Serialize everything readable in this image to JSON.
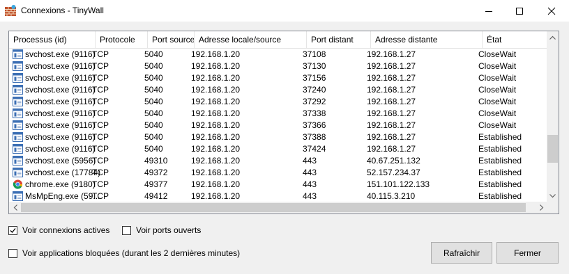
{
  "window": {
    "title": "Connexions - TinyWall"
  },
  "table": {
    "columns": [
      "Processus (id)",
      "Protocole",
      "Port source",
      "Adresse locale/source",
      "Port distant",
      "Adresse distante",
      "État"
    ],
    "rows": [
      {
        "icon": "svchost-icon",
        "process": "svchost.exe (9116)",
        "protocol": "TCP",
        "src_port": "5040",
        "local_addr": "192.168.1.20",
        "dst_port": "37108",
        "remote_addr": "192.168.1.27",
        "state": "CloseWait"
      },
      {
        "icon": "svchost-icon",
        "process": "svchost.exe (9116)",
        "protocol": "TCP",
        "src_port": "5040",
        "local_addr": "192.168.1.20",
        "dst_port": "37130",
        "remote_addr": "192.168.1.27",
        "state": "CloseWait"
      },
      {
        "icon": "svchost-icon",
        "process": "svchost.exe (9116)",
        "protocol": "TCP",
        "src_port": "5040",
        "local_addr": "192.168.1.20",
        "dst_port": "37156",
        "remote_addr": "192.168.1.27",
        "state": "CloseWait"
      },
      {
        "icon": "svchost-icon",
        "process": "svchost.exe (9116)",
        "protocol": "TCP",
        "src_port": "5040",
        "local_addr": "192.168.1.20",
        "dst_port": "37240",
        "remote_addr": "192.168.1.27",
        "state": "CloseWait"
      },
      {
        "icon": "svchost-icon",
        "process": "svchost.exe (9116)",
        "protocol": "TCP",
        "src_port": "5040",
        "local_addr": "192.168.1.20",
        "dst_port": "37292",
        "remote_addr": "192.168.1.27",
        "state": "CloseWait"
      },
      {
        "icon": "svchost-icon",
        "process": "svchost.exe (9116)",
        "protocol": "TCP",
        "src_port": "5040",
        "local_addr": "192.168.1.20",
        "dst_port": "37338",
        "remote_addr": "192.168.1.27",
        "state": "CloseWait"
      },
      {
        "icon": "svchost-icon",
        "process": "svchost.exe (9116)",
        "protocol": "TCP",
        "src_port": "5040",
        "local_addr": "192.168.1.20",
        "dst_port": "37366",
        "remote_addr": "192.168.1.27",
        "state": "CloseWait"
      },
      {
        "icon": "svchost-icon",
        "process": "svchost.exe (9116)",
        "protocol": "TCP",
        "src_port": "5040",
        "local_addr": "192.168.1.20",
        "dst_port": "37388",
        "remote_addr": "192.168.1.27",
        "state": "Established"
      },
      {
        "icon": "svchost-icon",
        "process": "svchost.exe (9116)",
        "protocol": "TCP",
        "src_port": "5040",
        "local_addr": "192.168.1.20",
        "dst_port": "37424",
        "remote_addr": "192.168.1.27",
        "state": "Established"
      },
      {
        "icon": "svchost-icon",
        "process": "svchost.exe (5956)",
        "protocol": "TCP",
        "src_port": "49310",
        "local_addr": "192.168.1.20",
        "dst_port": "443",
        "remote_addr": "40.67.251.132",
        "state": "Established"
      },
      {
        "icon": "svchost-icon",
        "process": "svchost.exe (17784)",
        "protocol": "TCP",
        "src_port": "49372",
        "local_addr": "192.168.1.20",
        "dst_port": "443",
        "remote_addr": "52.157.234.37",
        "state": "Established"
      },
      {
        "icon": "chrome-icon",
        "process": "chrome.exe (9180)",
        "protocol": "TCP",
        "src_port": "49377",
        "local_addr": "192.168.1.20",
        "dst_port": "443",
        "remote_addr": "151.101.122.133",
        "state": "Established"
      },
      {
        "icon": "svchost-icon",
        "process": "MsMpEng.exe (59...",
        "protocol": "TCP",
        "src_port": "49412",
        "local_addr": "192.168.1.20",
        "dst_port": "443",
        "remote_addr": "40.115.3.210",
        "state": "Established"
      }
    ]
  },
  "options": {
    "show_active": {
      "label": "Voir connexions actives",
      "checked": true
    },
    "show_open_ports": {
      "label": "Voir ports ouverts",
      "checked": false
    },
    "show_blocked": {
      "label": "Voir applications bloquées (durant les 2 dernières minutes)",
      "checked": false
    }
  },
  "buttons": {
    "refresh": "Rafraîchir",
    "close": "Fermer"
  },
  "colors": {
    "border": "#828790",
    "button_bg": "#e1e1e1",
    "window_bg": "#f0f0f0"
  }
}
